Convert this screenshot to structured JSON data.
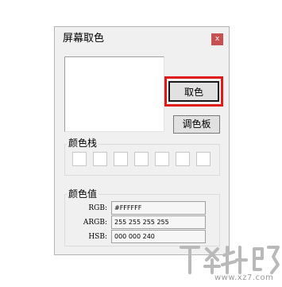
{
  "window": {
    "title": "屏幕取色",
    "close_glyph": "x"
  },
  "buttons": {
    "pick_color": "取色",
    "palette": "调色板"
  },
  "color_stack": {
    "label": "颜色栈",
    "swatches": [
      "#ffffff",
      "#ffffff",
      "#ffffff",
      "#ffffff",
      "#ffffff",
      "#ffffff",
      "#ffffff"
    ]
  },
  "color_values": {
    "label": "颜色值",
    "rows": [
      {
        "label": "RGB:",
        "value": "#FFFFFF"
      },
      {
        "label": "ARGB:",
        "value": "255 255 255 255"
      },
      {
        "label": "HSB:",
        "value": "000 000 240"
      }
    ]
  },
  "preview_color": "#ffffff",
  "highlight_color": "#e0191b",
  "watermark": {
    "brand_text": "www.xz7.com",
    "icon": "xiazaiba-logo-icon"
  }
}
